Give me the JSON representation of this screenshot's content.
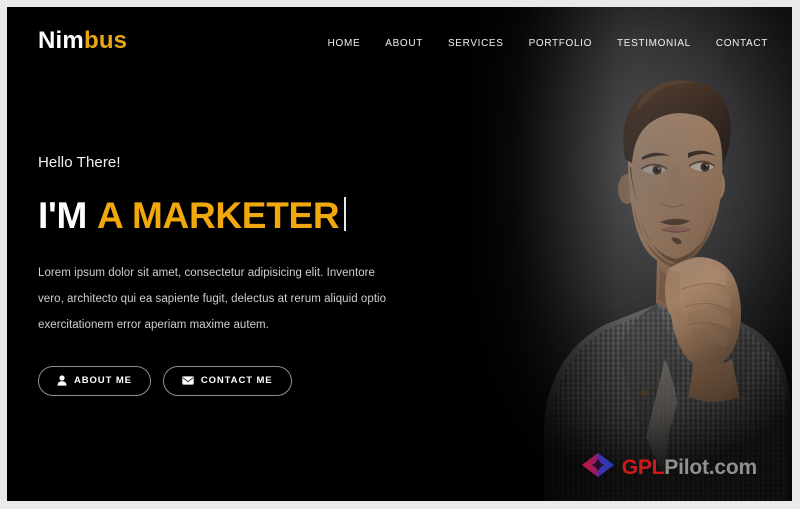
{
  "brand": {
    "name_part1": "Nim",
    "name_part2": "bus",
    "color_part1": "#ffffff",
    "color_part2": "#e9a612"
  },
  "nav": {
    "items": [
      {
        "label": "HOME",
        "name": "nav-item-home"
      },
      {
        "label": "ABOUT",
        "name": "nav-item-about"
      },
      {
        "label": "SERVICES",
        "name": "nav-item-services"
      },
      {
        "label": "PORTFOLIO",
        "name": "nav-item-portfolio"
      },
      {
        "label": "TESTIMONIAL",
        "name": "nav-item-testimonial"
      },
      {
        "label": "CONTACT",
        "name": "nav-item-contact"
      }
    ]
  },
  "hero": {
    "greeting": "Hello There!",
    "title_static": "I'M",
    "title_typed": "A MARKETER",
    "title_typed_color": "#f0a80c",
    "paragraph": "Lorem ipsum dolor sit amet, consectetur adipisicing elit. Inventore vero, architecto qui ea sapiente fugit, delectus at rerum aliquid optio exercitationem error aperiam maxime autem.",
    "buttons": [
      {
        "label": "ABOUT ME",
        "icon": "user-icon",
        "name": "about-me-button"
      },
      {
        "label": "CONTACT ME",
        "icon": "envelope-icon",
        "name": "contact-me-button"
      }
    ],
    "background_color": "#000000"
  },
  "watermark": {
    "text_part1": "GPL",
    "text_part2": "Pilot.com",
    "color_part1": "#e01b1b",
    "color_part2": "#9c9c9c",
    "logo": "gplpilot-diamond-logo"
  }
}
